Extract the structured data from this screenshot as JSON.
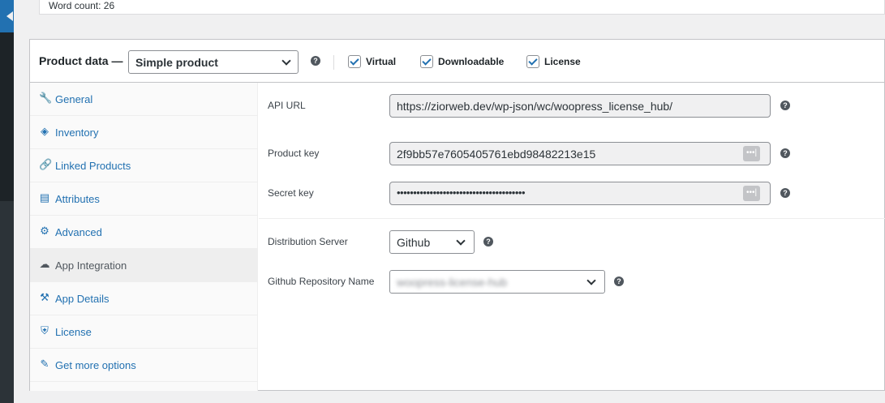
{
  "word_count": "Word count: 26",
  "product_data": {
    "title": "Product data —",
    "product_type": "Simple product",
    "help_icon": "?",
    "checkboxes": [
      {
        "label": "Virtual",
        "checked": true
      },
      {
        "label": "Downloadable",
        "checked": true
      },
      {
        "label": "License",
        "checked": true
      }
    ]
  },
  "tabs": [
    {
      "label": "General",
      "icon": "wrench-icon",
      "glyph": "🔧"
    },
    {
      "label": "Inventory",
      "icon": "tag-icon",
      "glyph": "◈"
    },
    {
      "label": "Linked Products",
      "icon": "link-icon",
      "glyph": "🔗"
    },
    {
      "label": "Attributes",
      "icon": "list-icon",
      "glyph": "▤"
    },
    {
      "label": "Advanced",
      "icon": "gear-icon",
      "glyph": "⚙"
    },
    {
      "label": "App Integration",
      "icon": "cloud-icon",
      "glyph": "☁",
      "active": true
    },
    {
      "label": "App Details",
      "icon": "tools-icon",
      "glyph": "⚒"
    },
    {
      "label": "License",
      "icon": "shield-icon",
      "glyph": "⛨"
    },
    {
      "label": "Get more options",
      "icon": "plugin-icon",
      "glyph": "✎"
    }
  ],
  "fields": {
    "api_url": {
      "label": "API URL",
      "value": "https://ziorweb.dev/wp-json/wc/woopress_license_hub/"
    },
    "product_key": {
      "label": "Product key",
      "value": "2f9bb57e7605405761ebd98482213e15"
    },
    "secret_key": {
      "label": "Secret key",
      "value": "•••••••••••••••••••••••••••••••••••••••"
    },
    "distribution_server": {
      "label": "Distribution Server",
      "value": "Github"
    },
    "github_repo": {
      "label": "Github Repository Name",
      "value": "woopress-license-hub"
    }
  },
  "password_toggle_glyph": "•••|",
  "colors": {
    "accent": "#2271b1",
    "border": "#c3c4c7",
    "admin_bar": "#1d2327"
  }
}
